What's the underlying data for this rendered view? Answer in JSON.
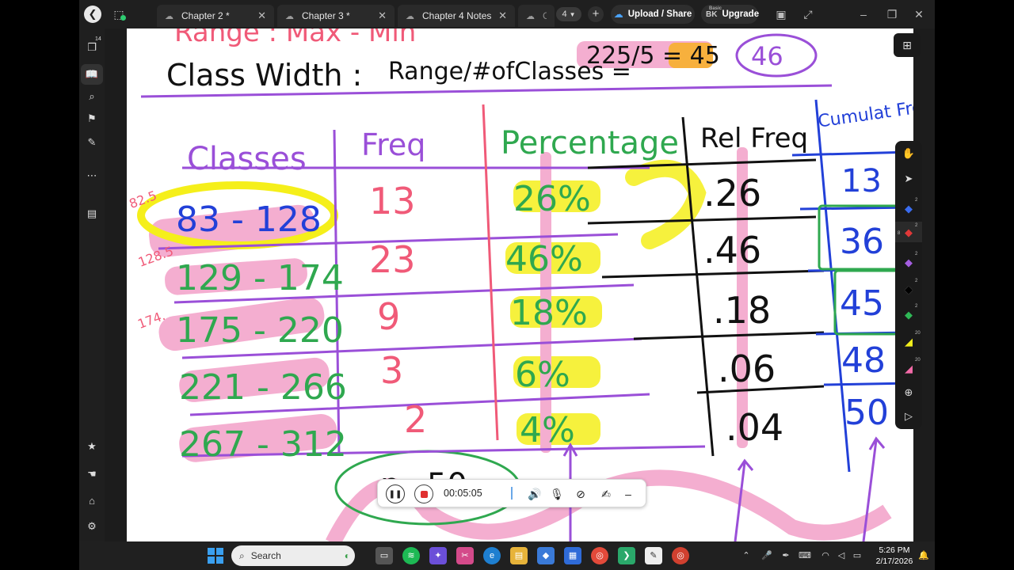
{
  "titlebar": {
    "tabs": [
      {
        "label": "Chapter 2 *"
      },
      {
        "label": "Chapter 3 *"
      },
      {
        "label": "Chapter 4 Notes *"
      },
      {
        "label": "Chap"
      }
    ],
    "tab_count": "4",
    "upload_label": "Upload / Share",
    "user_initials": "BK",
    "plan_label": "Basic",
    "upgrade_label": "Upgrade"
  },
  "left_toolbar": {
    "pages_badge": "14"
  },
  "right_toolbar": {
    "tool_sizes": [
      "2",
      "2",
      "2",
      "2",
      "2",
      "20",
      "20"
    ],
    "pen_size_active": "8"
  },
  "notes": {
    "header_range": "Range : Max - Min",
    "class_width_label": "Class Width :",
    "class_width_formula": "Range/#ofClasses =",
    "class_width_calc": "225/5 = 45",
    "class_width_rounded": "46",
    "column_headers": [
      "Classes",
      "Freq",
      "Percentage",
      "Rel Freq",
      "Cumulat Freq"
    ],
    "boundaries": [
      "82.5",
      "128.5",
      "174."
    ],
    "rows": [
      {
        "class": "83 - 128",
        "freq": "13",
        "pct": "26%",
        "rel": ".26",
        "cum": "13"
      },
      {
        "class": "129 - 174",
        "freq": "23",
        "pct": "46%",
        "rel": ".46",
        "cum": "36"
      },
      {
        "class": "175 - 220",
        "freq": "9",
        "pct": "18%",
        "rel": ".18",
        "cum": "45"
      },
      {
        "class": "221 - 266",
        "freq": "3",
        "pct": "6%",
        "rel": ".06",
        "cum": "48"
      },
      {
        "class": "267 - 312",
        "freq": "2",
        "pct": "4%",
        "rel": ".04",
        "cum": "50"
      }
    ],
    "bottom_note": "n=50"
  },
  "recording": {
    "elapsed": "00:05:05"
  },
  "taskbar": {
    "search_placeholder": "Search",
    "time": "5:26 PM",
    "date": "2/17/2026"
  },
  "colors": {
    "ink_purple": "#9a4fd8",
    "ink_pink": "#f05a78",
    "ink_green": "#2fa84f",
    "ink_blue": "#2240d8",
    "ink_black": "#111111",
    "highlight_yellow": "#f5ef1a",
    "highlight_pink": "#f3a0c8",
    "highlight_orange": "#f6a21a"
  }
}
